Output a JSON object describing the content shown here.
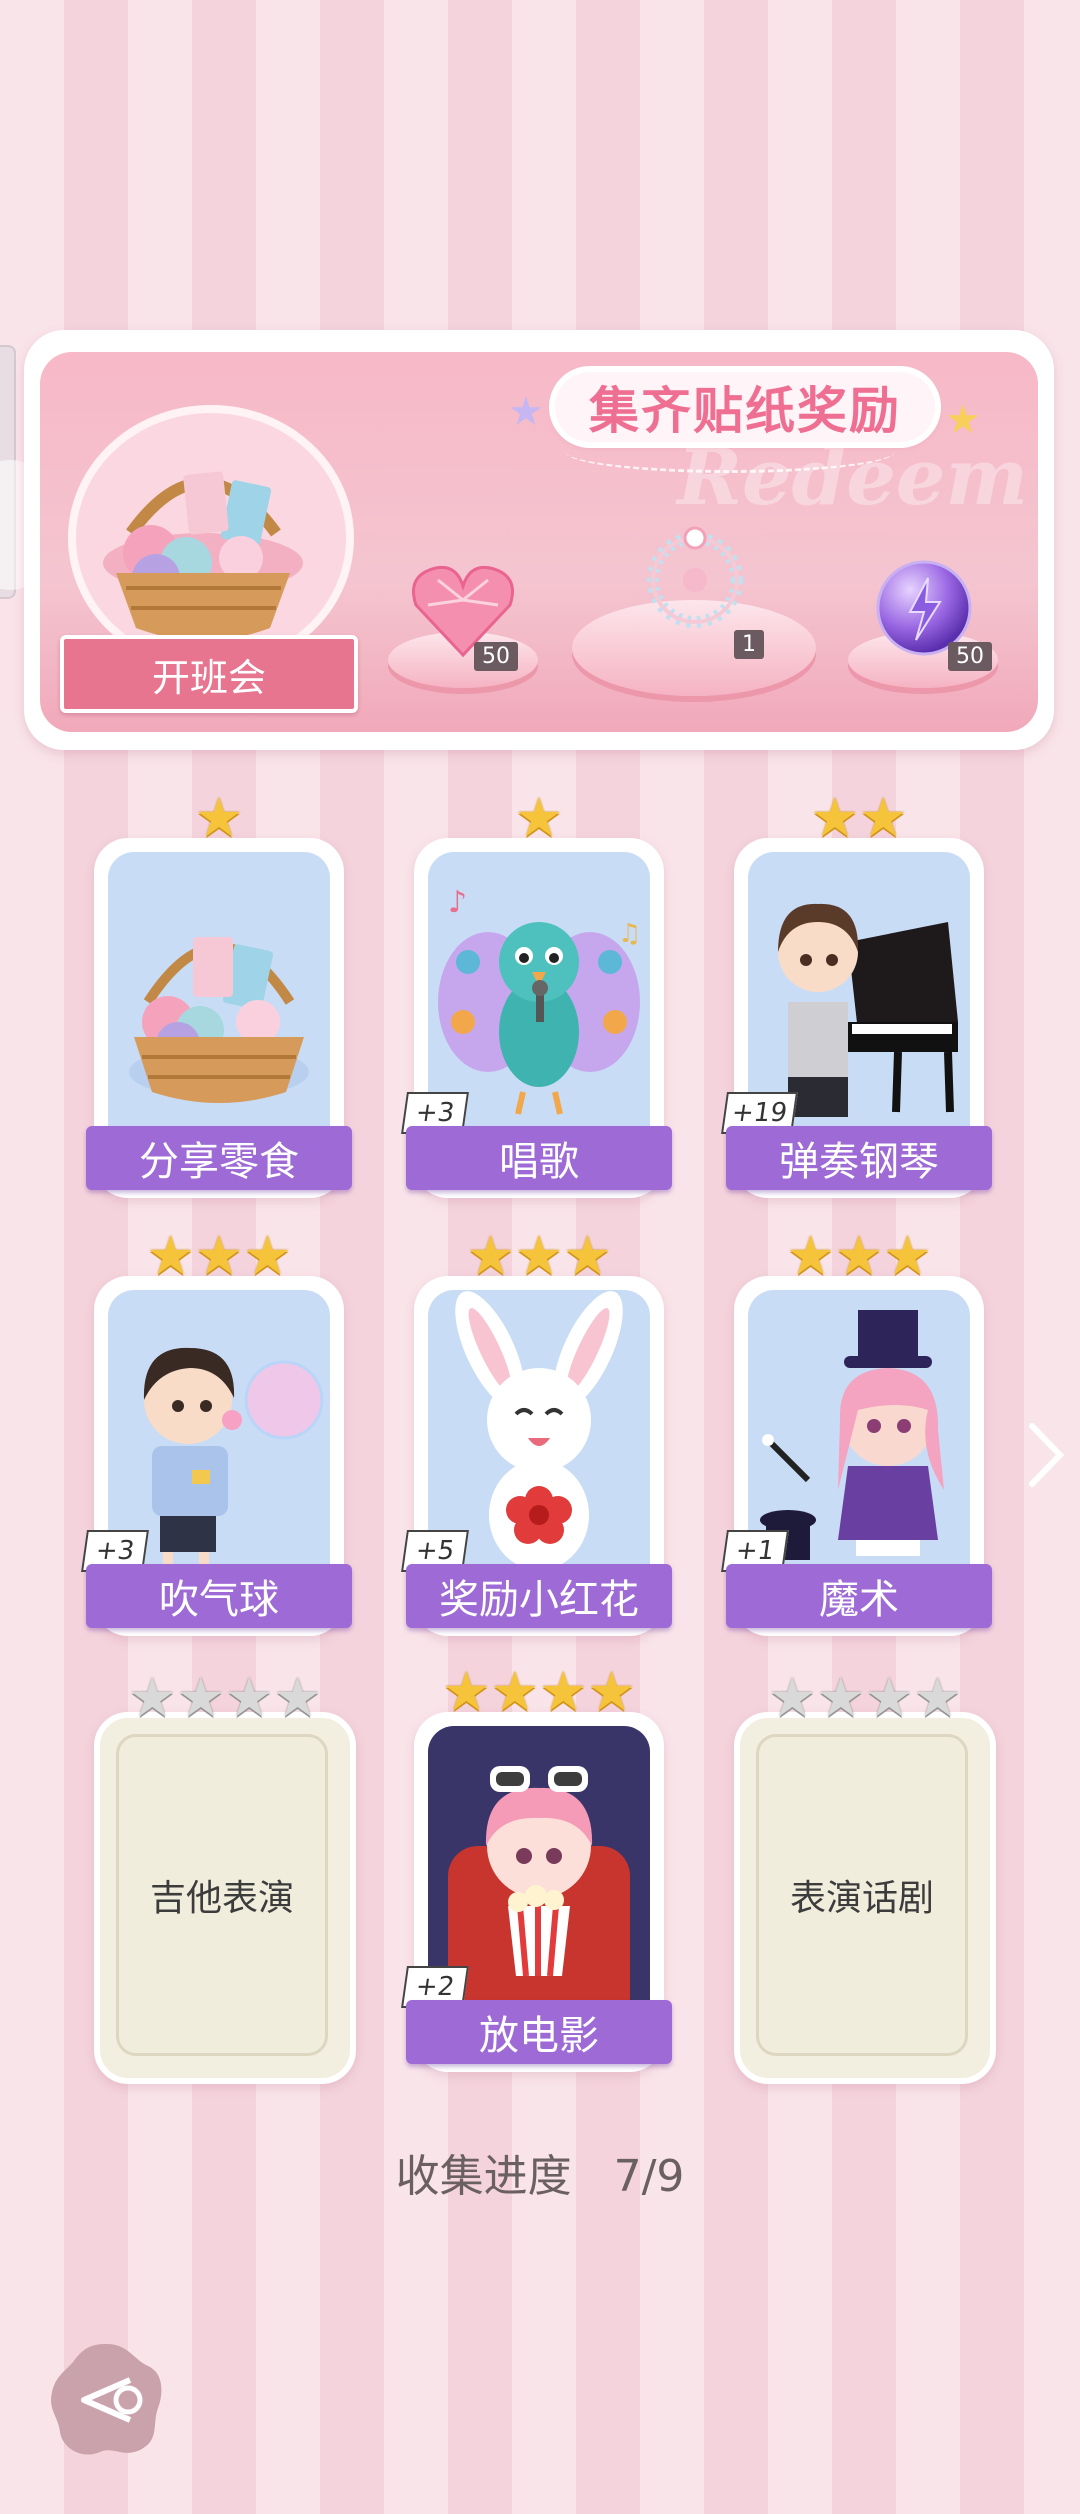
{
  "banner": {
    "title": "集齐贴纸奖励",
    "watermark": "Redeem",
    "event_label": "开班会",
    "rewards": [
      {
        "icon": "pink-heart-gem-icon",
        "count": "50"
      },
      {
        "icon": "pearl-bracelet-icon",
        "count": "1"
      },
      {
        "icon": "purple-lightning-orb-icon",
        "count": "50"
      }
    ]
  },
  "cards": [
    {
      "label": "分享零食",
      "stars": 1,
      "max_stars": 1,
      "plus": "",
      "art": "snack-basket-icon",
      "locked": false
    },
    {
      "label": "唱歌",
      "stars": 1,
      "max_stars": 1,
      "plus": "+3",
      "art": "singing-peacock-icon",
      "locked": false
    },
    {
      "label": "弹奏钢琴",
      "stars": 2,
      "max_stars": 2,
      "plus": "+19",
      "art": "boy-piano-icon",
      "locked": false
    },
    {
      "label": "吹气球",
      "stars": 3,
      "max_stars": 3,
      "plus": "+3",
      "art": "boy-bubble-icon",
      "locked": false
    },
    {
      "label": "奖励小红花",
      "stars": 3,
      "max_stars": 3,
      "plus": "+5",
      "art": "bunny-flower-icon",
      "locked": false
    },
    {
      "label": "魔术",
      "stars": 3,
      "max_stars": 3,
      "plus": "+1",
      "art": "girl-magician-icon",
      "locked": false
    },
    {
      "label": "吉他表演",
      "stars": 0,
      "max_stars": 4,
      "plus": "",
      "art": "",
      "locked": true
    },
    {
      "label": "放电影",
      "stars": 4,
      "max_stars": 4,
      "plus": "+2",
      "art": "girl-popcorn-icon",
      "locked": false
    },
    {
      "label": "表演话剧",
      "stars": 0,
      "max_stars": 4,
      "plus": "",
      "art": "",
      "locked": true
    }
  ],
  "progress": {
    "label": "收集进度",
    "value": "7/9",
    "collected": 7,
    "total": 9
  },
  "colors": {
    "card_label": "#9e6ad6",
    "star_gold": "#f6c43a",
    "star_grey": "#d9d9d9",
    "banner_pink": "#f7b8c7",
    "title_pink": "#ef6f93"
  }
}
